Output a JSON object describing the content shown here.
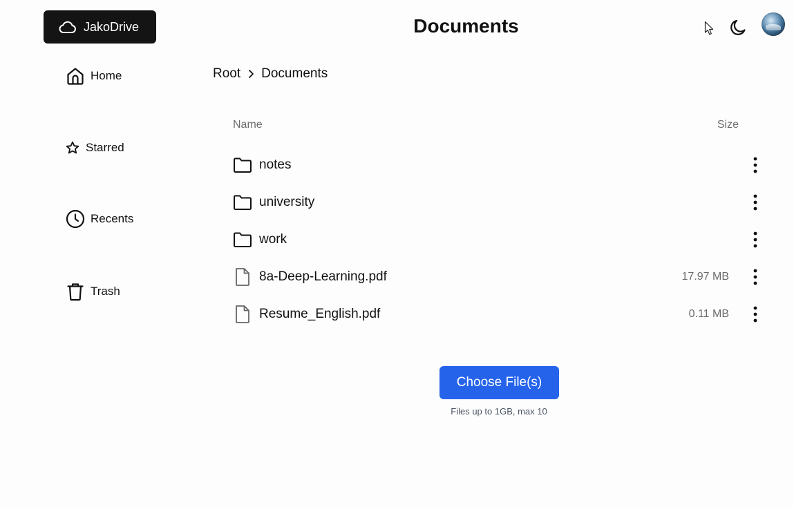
{
  "app": {
    "brand": "JakoDrive",
    "page_title": "Documents"
  },
  "sidebar": {
    "items": [
      {
        "label": "Home",
        "icon": "home-icon"
      },
      {
        "label": "Starred",
        "icon": "star-icon"
      },
      {
        "label": "Recents",
        "icon": "clock-icon"
      },
      {
        "label": "Trash",
        "icon": "trash-icon"
      }
    ]
  },
  "breadcrumb": {
    "items": [
      "Root",
      "Documents"
    ]
  },
  "table": {
    "headers": {
      "name": "Name",
      "size": "Size"
    },
    "rows": [
      {
        "type": "folder",
        "name": "notes",
        "size": ""
      },
      {
        "type": "folder",
        "name": "university",
        "size": ""
      },
      {
        "type": "folder",
        "name": "work",
        "size": ""
      },
      {
        "type": "file",
        "name": "8a-Deep-Learning.pdf",
        "size": "17.97 MB"
      },
      {
        "type": "file",
        "name": "Resume_English.pdf",
        "size": "0.11 MB"
      }
    ]
  },
  "upload": {
    "button_label": "Choose File(s)",
    "hint": "Files up to 1GB, max 10"
  },
  "colors": {
    "accent": "#2563eb",
    "logo_bg": "#141414",
    "muted_text": "#6b6b6b"
  }
}
